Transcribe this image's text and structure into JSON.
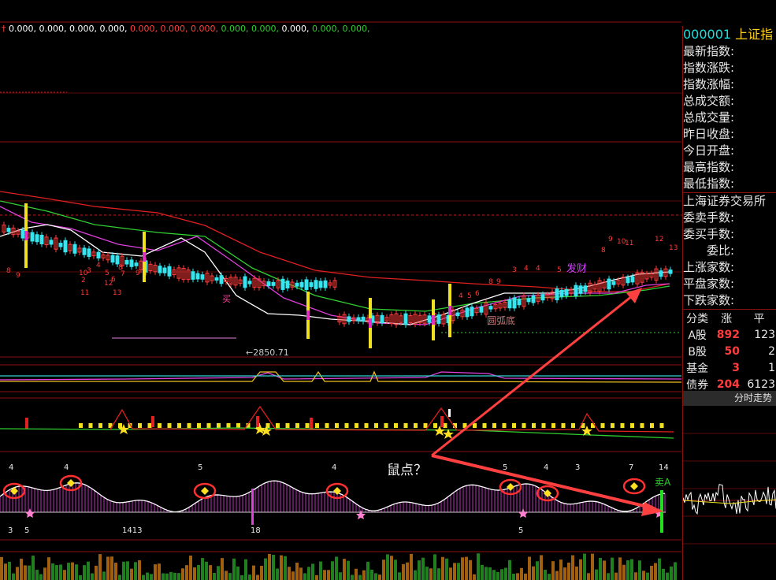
{
  "indicator_header": {
    "prefix": "†",
    "values": [
      "0.000,",
      "0.000,",
      "0.000,",
      "0.000,",
      "0.000,",
      "0.000,",
      "0.000,",
      "0.000,",
      "0.000,",
      "0.000,",
      "0.000,",
      "0.000,"
    ]
  },
  "price_chart": {
    "low_label": "←2850.71",
    "pattern_label": "圆弧底",
    "signal_label": "发财",
    "buy_label": "买",
    "sell_label": "卖A"
  },
  "annotation": {
    "question": "鼠点？"
  },
  "right_panel": {
    "code": "000001",
    "name": "上证指",
    "fields": [
      "最新指数:",
      "指数涨跌:",
      "指数涨幅:",
      "总成交额:",
      "总成交量:",
      "昨日收盘:",
      "今日开盘:",
      "最高指数:",
      "最低指数:"
    ],
    "exchange": "上海证券交易所",
    "order_fields": [
      "委卖手数:",
      "委买手数:"
    ],
    "ratio_label": "委比:",
    "count_fields": [
      "上涨家数:",
      "平盘家数:",
      "下跌家数:"
    ],
    "table_header": [
      "分类",
      "涨",
      "平"
    ],
    "table_rows": [
      {
        "cat": "A股",
        "up": "892",
        "flat": "123"
      },
      {
        "cat": "B股",
        "up": "50",
        "flat": "2"
      },
      {
        "cat": "基金",
        "up": "3",
        "flat": "1"
      },
      {
        "cat": "债券",
        "up": "204",
        "flat": "6123"
      }
    ],
    "intraday_tab": "分时走势"
  },
  "colors": {
    "up": "#ff3b3b",
    "down": "#35e6f0",
    "grid": "#8a1010",
    "ma_white": "#ffffff",
    "ma_magenta": "#e040e0",
    "ma_green": "#30d030",
    "ma_red": "#e02020",
    "arrow": "#ff4040"
  }
}
